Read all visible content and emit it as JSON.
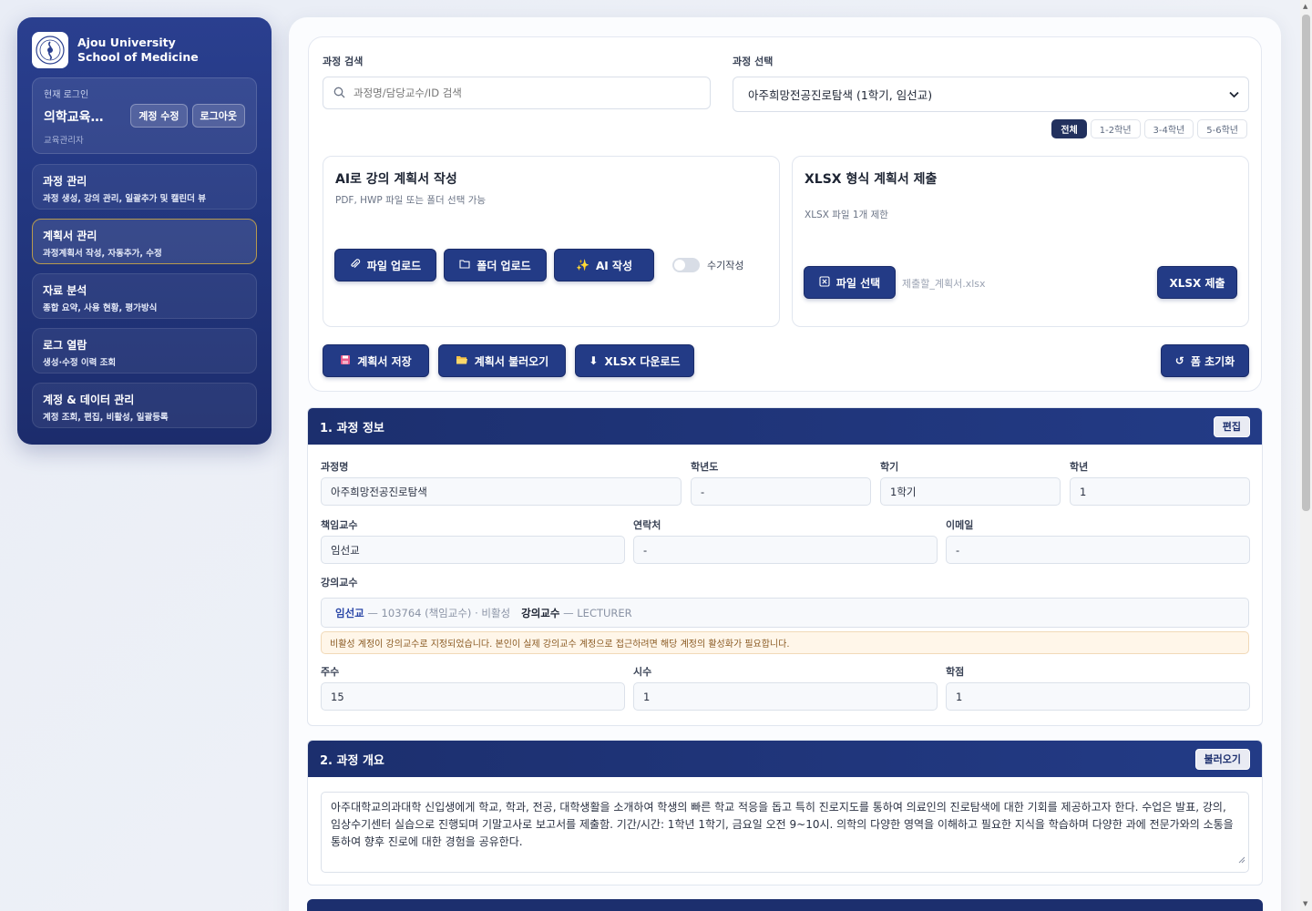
{
  "brand": {
    "line1": "Ajou University",
    "line2": "School of Medicine"
  },
  "login": {
    "label": "현재 로그인",
    "name": "의학교육…",
    "role": "교육관리자",
    "edit_button": "계정 수정",
    "logout_button": "로그아웃"
  },
  "nav": [
    {
      "title": "과정 관리",
      "sub": "과정 생성, 강의 관리, 일괄추가 및 캘린더 뷰",
      "active": false
    },
    {
      "title": "계획서 관리",
      "sub": "과정계획서 작성, 자동추가, 수정",
      "active": true
    },
    {
      "title": "자료 분석",
      "sub": "종합 요약, 사용 현황, 평가방식",
      "active": false
    },
    {
      "title": "로그 열람",
      "sub": "생성·수정 이력 조회",
      "active": false
    },
    {
      "title": "계정 & 데이터 관리",
      "sub": "계정 조회, 편집, 비활성, 일괄등록",
      "active": false
    }
  ],
  "search": {
    "label": "과정 검색",
    "placeholder": "과정명/담당교수/ID 검색"
  },
  "course_select": {
    "label": "과정 선택",
    "value": "아주희망전공진로탐색 (1학기, 임선교)"
  },
  "year_filter": [
    "전체",
    "1-2학년",
    "3-4학년",
    "5-6학년"
  ],
  "ai_card": {
    "title": "AI로 강의 계획서 작성",
    "subtitle": "PDF, HWP 파일 또는 폴더 선택 가능",
    "file_upload": "파일 업로드",
    "folder_upload": "폴더 업로드",
    "ai_write": "AI 작성",
    "manual_toggle": "수기작성"
  },
  "xlsx_card": {
    "title": "XLSX 형식 계획서 제출",
    "subtitle": "XLSX 파일 1개 제한",
    "file_select": "파일 선택",
    "file_placeholder": "제출할_계획서.xlsx",
    "submit": "XLSX 제출"
  },
  "actions": {
    "save": "계획서 저장",
    "load": "계획서 불러오기",
    "download": "XLSX 다운로드",
    "reset": "폼 초기화"
  },
  "section1": {
    "title": "1. 과정 정보",
    "edit_button": "편집",
    "fields": {
      "course_name": {
        "label": "과정명",
        "value": "아주희망전공진로탐색"
      },
      "year": {
        "label": "학년도",
        "value": "-"
      },
      "semester": {
        "label": "학기",
        "value": "1학기"
      },
      "grade": {
        "label": "학년",
        "value": "1"
      },
      "professor": {
        "label": "책임교수",
        "value": "임선교"
      },
      "contact": {
        "label": "연락처",
        "value": "-"
      },
      "email": {
        "label": "이메일",
        "value": "-"
      },
      "weeks": {
        "label": "주수",
        "value": "15"
      },
      "hours": {
        "label": "시수",
        "value": "1"
      },
      "credits": {
        "label": "학점",
        "value": "1"
      }
    },
    "lecturers_label": "강의교수",
    "lecturers": [
      {
        "name": "임선교",
        "meta": "— 103764 (책임교수) · 비활성"
      },
      {
        "name": "강의교수",
        "meta": "— LECTURER"
      }
    ],
    "warning": "비활성 계정이 강의교수로 지정되었습니다. 본인이 실제 강의교수 계정으로 접근하려면 해당 계정의 활성화가 필요합니다."
  },
  "section2": {
    "title": "2. 과정 개요",
    "load_button": "불러오기",
    "text": "아주대학교의과대학 신입생에게 학교, 학과, 전공, 대학생활을 소개하여 학생의 빠른 학교 적응을 돕고 특히 진로지도를 통하여 의료인의 진로탐색에 대한 기회를 제공하고자 한다. 수업은 발표, 강의, 임상수기센터 실습으로 진행되며 기말고사로 보고서를 제출함. 기간/시간: 1학년 1학기, 금요일 오전 9~10시. 의학의 다양한 영역을 이해하고 필요한 지식을 학습하며 다양한 과에 전문가와의 소통을 통하여 향후 진로에 대한 경험을 공유한다."
  }
}
